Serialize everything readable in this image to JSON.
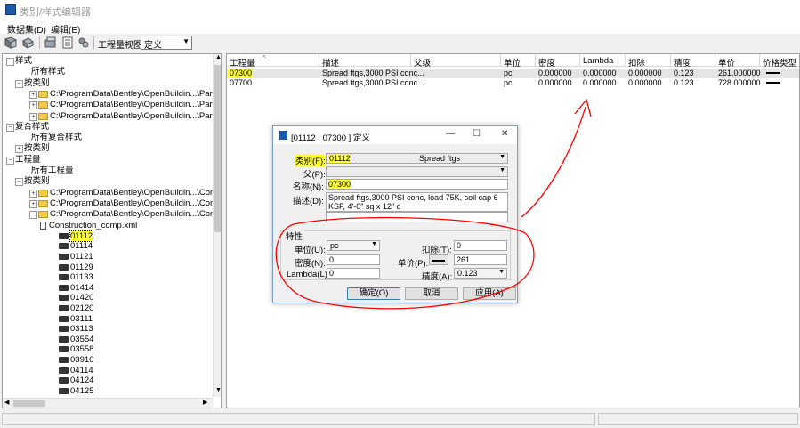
{
  "app": {
    "title": "类别/样式编辑器"
  },
  "menu": [
    {
      "label": "数据集",
      "key": "D"
    },
    {
      "label": "编辑",
      "key": "E"
    }
  ],
  "toolbar": {
    "view_label": "工程量视图",
    "view_value": "定义"
  },
  "tree": {
    "nodes": [
      {
        "label": "样式",
        "type": "root"
      },
      {
        "label": "所有样式",
        "type": "leaf"
      },
      {
        "label": "按类别",
        "type": "group"
      },
      {
        "label": "C:\\ProgramData\\Bentley\\OpenBuildin...\\Part\\",
        "type": "folder"
      },
      {
        "label": "C:\\ProgramData\\Bentley\\OpenBuildin...\\Part\\",
        "type": "folder"
      },
      {
        "label": "C:\\ProgramData\\Bentley\\OpenBuildin...\\Part\\",
        "type": "folder"
      },
      {
        "label": "复合样式",
        "type": "root"
      },
      {
        "label": "所有复合样式",
        "type": "leaf"
      },
      {
        "label": "按类别",
        "type": "group"
      },
      {
        "label": "工程量",
        "type": "root"
      },
      {
        "label": "所有工程量",
        "type": "leaf"
      },
      {
        "label": "按类别",
        "type": "group"
      },
      {
        "label": "C:\\ProgramData\\Bentley\\OpenBuildin...\\Comp\\",
        "type": "folder"
      },
      {
        "label": "C:\\ProgramData\\Bentley\\OpenBuildin...\\Comp\\",
        "type": "folder"
      },
      {
        "label": "C:\\ProgramData\\Bentley\\OpenBuildin...\\Comp\\",
        "type": "folder-open"
      },
      {
        "label": "Construction_comp.xml",
        "type": "file"
      }
    ],
    "codes": [
      "01112",
      "01114",
      "01121",
      "01129",
      "01133",
      "01414",
      "01420",
      "02120",
      "03111",
      "03113",
      "03554",
      "03558",
      "03910",
      "04114",
      "04124",
      "04125"
    ]
  },
  "list": {
    "headers": [
      "工程量",
      "描述",
      "父级",
      "单位",
      "密度",
      "Lambda",
      "扣除",
      "精度",
      "单价",
      "价格类型"
    ],
    "rows": [
      {
        "code": "07300",
        "desc": "Spread ftgs,3000 PSI conc...",
        "parent": "",
        "unit": "pc",
        "density": "0.000000",
        "lambda": "0.000000",
        "deduct": "0.000000",
        "precision": "0.123",
        "price": "261.000000"
      },
      {
        "code": "07700",
        "desc": "Spread ftgs,3000 PSI conc...",
        "parent": "",
        "unit": "pc",
        "density": "0.000000",
        "lambda": "0.000000",
        "deduct": "0.000000",
        "precision": "0.123",
        "price": "728.000000"
      }
    ]
  },
  "dialog": {
    "title": "[01112 : 07300 ] 定义",
    "category_label": "类别(F):",
    "category_code": "01112",
    "category_name": "Spread ftgs",
    "parent_label": "父(P):",
    "name_label": "名称(N):",
    "name_value": "07300",
    "desc_label": "描述(D):",
    "desc_value": "Spread ftgs,3000 PSI conc, load 75K, soil cap 6 KSF, 4'-0\" sq x 12\" d",
    "props_title": "特性",
    "unit_label": "单位(U):",
    "unit_value": "pc",
    "deduct_label": "扣除(T):",
    "deduct_value": "0",
    "density_label": "密度(N):",
    "density_value": "0",
    "price_label": "单价(P):",
    "price_value": "261",
    "lambda_label": "Lambda(L):",
    "lambda_value": "0",
    "precision_label": "精度(A):",
    "precision_value": "0.123",
    "ok": "确定(O)",
    "cancel": "取消",
    "apply": "应用(A)"
  },
  "colors": {
    "highlight": "#ffff33",
    "annotation": "#ff0000",
    "accent": "#1a5aa8"
  }
}
